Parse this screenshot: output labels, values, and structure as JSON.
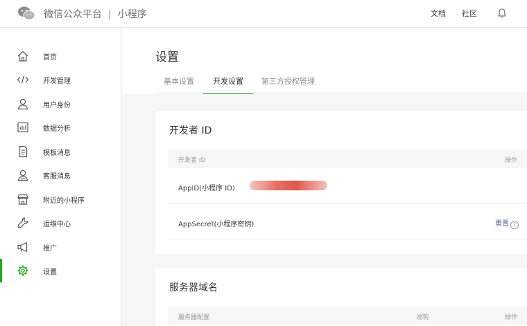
{
  "header": {
    "brand": "微信公众平台",
    "separator": "|",
    "product": "小程序",
    "links": {
      "docs": "文档",
      "community": "社区"
    },
    "icons": {
      "logo": "wechat-logo-icon",
      "notifications": "bell-icon"
    }
  },
  "sidebar": {
    "items": [
      {
        "label": "首页",
        "icon": "home-icon"
      },
      {
        "label": "开发管理",
        "icon": "code-icon"
      },
      {
        "label": "用户身份",
        "icon": "user-icon"
      },
      {
        "label": "数据分析",
        "icon": "chart-icon"
      },
      {
        "label": "模板消息",
        "icon": "document-icon"
      },
      {
        "label": "客服消息",
        "icon": "customer-service-icon"
      },
      {
        "label": "附近的小程序",
        "icon": "store-icon"
      },
      {
        "label": "运维中心",
        "icon": "wrench-icon"
      },
      {
        "label": "推广",
        "icon": "megaphone-icon"
      },
      {
        "label": "设置",
        "icon": "gear-icon",
        "active": true
      }
    ],
    "accent_color": "#1aad19"
  },
  "main": {
    "title": "设置",
    "tabs": [
      {
        "label": "基本设置"
      },
      {
        "label": "开发设置",
        "active": true
      },
      {
        "label": "第三方授权管理"
      }
    ],
    "developer_section": {
      "title": "开发者 ID",
      "columns": {
        "name": "开发者 ID",
        "action": "操作"
      },
      "rows": [
        {
          "label": "AppID(小程序 ID)",
          "value_masked": true
        },
        {
          "label": "AppSecret(小程序密钥)",
          "action": "重置",
          "help": "?"
        }
      ]
    },
    "server_section": {
      "title": "服务器域名",
      "columns": {
        "config": "服务器配置",
        "desc": "说明",
        "action": "操作"
      }
    }
  }
}
